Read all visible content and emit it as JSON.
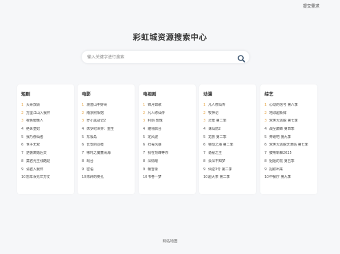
{
  "header": {
    "submit_link": "提交需求"
  },
  "title": "彩虹城资源搜索中心",
  "search": {
    "placeholder": "输入关键字进行搜索",
    "icon": "search-icon"
  },
  "categories": [
    {
      "title": "短剧",
      "items": [
        "大哥双顾",
        "万里江山入我怀",
        "夜色暧晚人",
        "绝世皇妃",
        "我乃修仙者",
        "世子无双",
        "逆袭离婚后天",
        "莫君光王残酷妃",
        "请君入我怀",
        "怒年误光芒万丈"
      ]
    },
    {
      "title": "电影",
      "items": [
        "浪迹山中好哥",
        "南京照相馆",
        "罗小黑战记2",
        "侏罗纪世界：重生",
        "东极岛",
        "长安的荔枝",
        "哪吒之魔童闹海",
        "戏台",
        "密语",
        "陈醉的雾孔"
      ]
    },
    {
      "title": "电视剧",
      "items": [
        "锦月如歌",
        "凡人修仙传",
        "利剑·玫瑰",
        "雕翎启台",
        "定风波",
        "扫毒风暴",
        "我在顶峰等你",
        "深情眼",
        "朝雪录",
        "书卷一梦"
      ]
    },
    {
      "title": "动漫",
      "items": [
        "凡人修仙传",
        "牧神记",
        "灵笼 第二季",
        "诛仙前2",
        "龙族 第二季",
        "镖动之海 第二季",
        "诡秘之主",
        "云深不知梦",
        "仙逆3号 第二季",
        "超大茶 第二季"
      ]
    },
    {
      "title": "综艺",
      "items": [
        "心动的信号 第八季",
        "地球超新鲜",
        "欢笑大逃脱 第七季",
        "战至巅峰 第四季",
        "奔跑吧 第九季",
        "欢笑大逃脱天津站 第七季",
        "披荆斩棘2025",
        "姐姐的花 第五季",
        "招职出来",
        "中餐厅 第九季"
      ]
    }
  ],
  "footer": {
    "sitemap": "网站地图"
  }
}
